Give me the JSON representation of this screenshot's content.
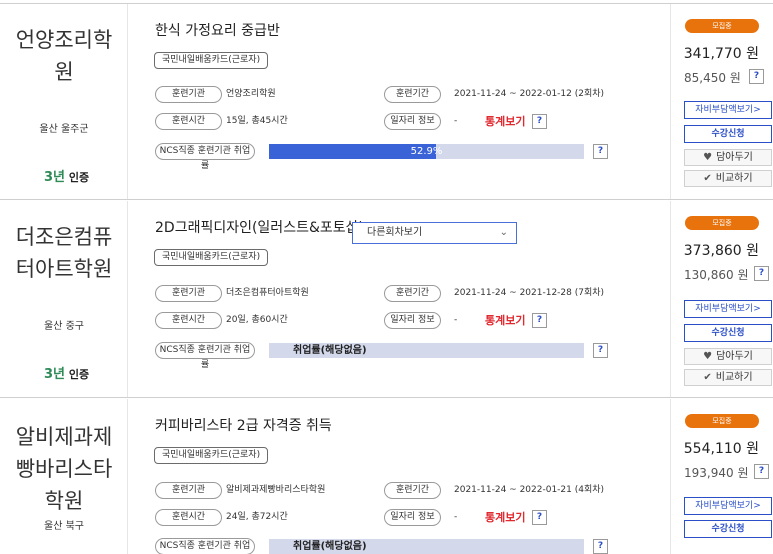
{
  "common": {
    "labels": {
      "institution": "훈련기관",
      "period": "훈련기간",
      "hours": "훈련시간",
      "job_info": "일자리 정보",
      "ncs_rate": "NCS직종 훈련기관 취업률"
    },
    "card_tag": "국민내일배움카드(근로자)",
    "stats": "통계보기",
    "help": "?",
    "dash": "-",
    "badge": "모집중",
    "self_pay_button": "자비부담액보기>",
    "apply_button": "수강신청",
    "wishlist_button": "담아두기",
    "compare_button": "비교하기",
    "cert_num": "3년",
    "cert_text": "인증"
  },
  "courses": [
    {
      "institution_name_lines": [
        "언양조리학",
        "원"
      ],
      "region": "울산 울주군",
      "title": "한식 가정요리 중급반",
      "institution": "언양조리학원",
      "period": "2021-11-24 ~ 2022-01-12 (2회차)",
      "hours": "15일, 총45시간",
      "employment_rate": 52.9,
      "employment_rate_label": "52.9%",
      "price": "341,770 원",
      "self_pay": "85,450 원"
    },
    {
      "institution_name_lines": [
        "더조은컴퓨",
        "터아트학원"
      ],
      "region": "울산 중구",
      "title": "2D그래픽디자인(일러스트&포토샵)",
      "institution": "더조은컴퓨터아트학원",
      "period": "2021-11-24 ~ 2021-12-28 (7회차)",
      "hours": "20일, 총60시간",
      "employment_rate_label": "취업률(해당없음)",
      "dropdown": "다른회차보기",
      "price": "373,860 원",
      "self_pay": "130,860 원"
    },
    {
      "institution_name_lines": [
        "알비제과제",
        "빵바리스타",
        "학원"
      ],
      "region": "울산 북구",
      "title": "커피바리스타 2급 자격증 취득",
      "institution": "알비제과제빵바리스타학원",
      "period": "2021-11-24 ~ 2022-01-21 (4회차)",
      "hours": "24일, 총72시간",
      "employment_rate_label": "취업률(해당없음)",
      "price": "554,110 원",
      "self_pay": "193,940 원"
    }
  ]
}
